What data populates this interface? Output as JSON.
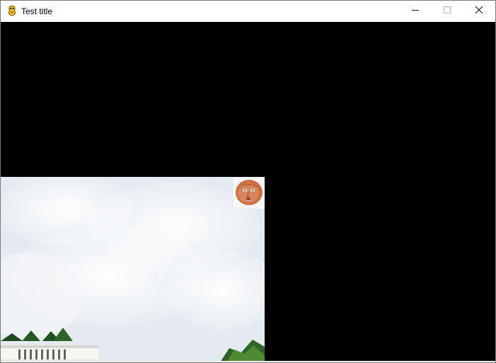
{
  "window": {
    "title": "Test title",
    "icon": "pygame-snake-icon"
  },
  "controls": {
    "minimize": "minimize-icon",
    "maximize": "maximize-icon",
    "close": "close-icon"
  },
  "colors": {
    "background": "#000000",
    "titlebar": "#ffffff",
    "photo_sky": "#eef2f5"
  },
  "game": {
    "background_image": "white-house-photo",
    "sprite_image": "face-sprite"
  }
}
